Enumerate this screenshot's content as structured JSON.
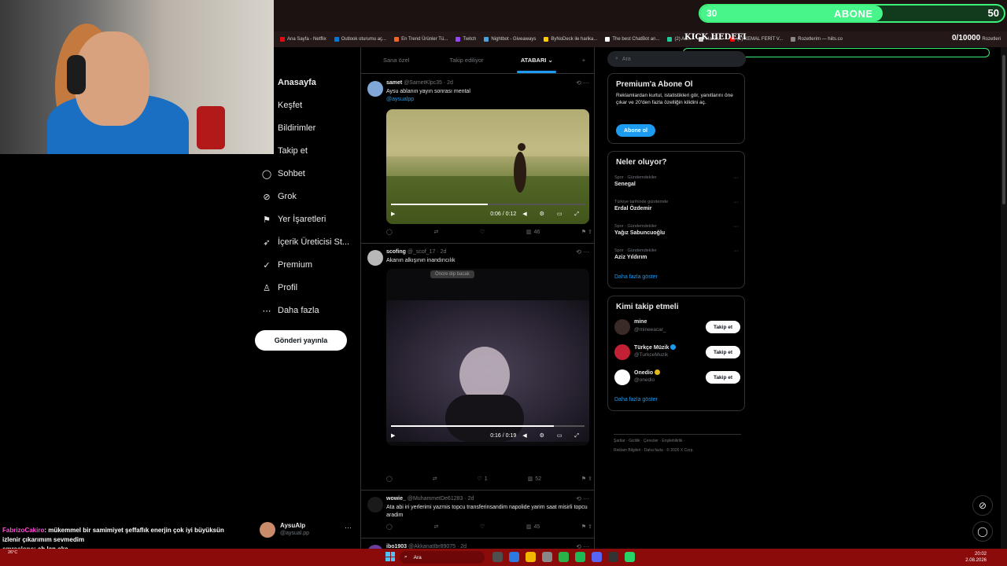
{
  "bookmarks": [
    {
      "label": "Ana Sayfa - Netflix",
      "color": "#e50914"
    },
    {
      "label": "Outlook oturumu aç...",
      "color": "#0078d4"
    },
    {
      "label": "En Trend Ürünler Tü...",
      "color": "#f26522"
    },
    {
      "label": "Twitch",
      "color": "#9146ff"
    },
    {
      "label": "Nightbot - Giveaways",
      "color": "#4aa3df"
    },
    {
      "label": "ByNoDeck ile harika...",
      "color": "#ffcc00"
    },
    {
      "label": "The best ChatBot an...",
      "color": "#ffffff"
    },
    {
      "label": "(2) Ac...",
      "color": "#20c997"
    },
    {
      "label": "Harek...",
      "color": "#cccccc"
    },
    {
      "label": "(1) KEMAL FERİT V...",
      "color": "#ff0000"
    },
    {
      "label": "Rozetlerim — hiits.co",
      "color": "#888888"
    }
  ],
  "bookmarks_more": "Rozetleri",
  "overlay": {
    "goal_start": "30",
    "goal_label": "ABONE",
    "goal_end": "50",
    "goal_progress": 0.6,
    "kick_title": "KICK HEDEFI",
    "kick_count": "0/10000"
  },
  "nav": {
    "items": [
      {
        "label": "Anasayfa",
        "icon": "home-icon",
        "glyph": "⌂"
      },
      {
        "label": "Keşfet",
        "icon": "search-icon",
        "glyph": "⌕"
      },
      {
        "label": "Bildirimler",
        "icon": "bell-icon",
        "glyph": "♪"
      },
      {
        "label": "Takip et",
        "icon": "person-plus-icon",
        "glyph": "☺"
      },
      {
        "label": "Sohbet",
        "icon": "chat-bubble-icon",
        "glyph": "◯"
      },
      {
        "label": "Grok",
        "icon": "grok-icon",
        "glyph": "⊘"
      },
      {
        "label": "Yer İşaretleri",
        "icon": "bookmark-icon",
        "glyph": "⚑"
      },
      {
        "label": "İçerik Üreticisi St...",
        "icon": "rocket-icon",
        "glyph": "➶"
      },
      {
        "label": "Premium",
        "icon": "premium-icon",
        "glyph": "✓"
      },
      {
        "label": "Profil",
        "icon": "profile-icon",
        "glyph": "♙"
      },
      {
        "label": "Daha fazla",
        "icon": "more-circle-icon",
        "glyph": "⋯"
      }
    ],
    "post_button": "Gönderi yayınla"
  },
  "account": {
    "name": "AysuAlp",
    "handle": "@aysual.pp",
    "more": "···"
  },
  "feed": {
    "tabs": [
      {
        "label": "Sana özel",
        "active": false
      },
      {
        "label": "Takip ediliyor",
        "active": false
      },
      {
        "label": "ATABARI ⌄",
        "active": true
      }
    ],
    "tab_add": "+",
    "posts": [
      {
        "author": "samet",
        "handle": "@SametKlpc35 · 2d",
        "text": "Aysu ablanın yayın sonrası mental",
        "link": "@aysualpp",
        "avatar_color": "#7fa8d8",
        "time": "0:06 / 0:12",
        "progress": 0.5,
        "likes": "",
        "views": "46"
      },
      {
        "author": "scofing",
        "handle": "@_scof_17 · 2d",
        "text": "Akanın alkışının inandırıcılık",
        "link": "",
        "avatar_color": "#b8b8b8",
        "chip": "Öncre dip bacak",
        "time": "0:16 / 0:19",
        "progress": 0.84,
        "likes": "1",
        "views": "52"
      },
      {
        "author": "wowie_",
        "handle": "@MuhammetDe61283 · 2d",
        "text": "Ata abi iri yerlerimi yazmis topcu transferinsandim napolide yarim saat misirli topcu aradim",
        "link": "",
        "avatar_color": "#1a1a1a",
        "views": "45"
      },
      {
        "author": "ibo1903",
        "handle": "@AkkanatIbr89075 · 2d",
        "text": "",
        "link": "",
        "avatar_color": "#6b3fa0"
      }
    ]
  },
  "search": {
    "placeholder": "Ara"
  },
  "premium": {
    "title": "Premium'a Abone Ol",
    "text": "Reklamlardan kurtul, istatistikleri gör, yanıtlarını öne çıkar ve 20'den fazla özelliğin kilidini aç.",
    "button": "Abone ol"
  },
  "trends": {
    "title": "Neler oluyor?",
    "items": [
      {
        "category": "Spor · Gündemdekiler",
        "name": "Senegal"
      },
      {
        "category": "Türkiye tarihinde gündemde",
        "name": "Erdal Özdemir"
      },
      {
        "category": "Spor · Gündemdekiler",
        "name": "Yağız Sabuncuoğlu"
      },
      {
        "category": "Spor · Gündemdekiler",
        "name": "Aziz Yıldırım"
      }
    ],
    "show_more": "Daha fazla göster"
  },
  "who_to_follow": {
    "title": "Kimi takip etmeli",
    "items": [
      {
        "name": "mine",
        "handle": "@mineeacar_",
        "button": "Takip et",
        "avatar_color": "#3a2a25",
        "badge": ""
      },
      {
        "name": "Türkçe Müzik",
        "handle": "@TurkceMuzik",
        "button": "Takip et",
        "avatar_color": "#c22035",
        "badge": "blue"
      },
      {
        "name": "Onedio",
        "handle": "@onedio",
        "button": "Takip et",
        "avatar_color": "#ffffff",
        "badge": "gold"
      }
    ],
    "show_more": "Daha fazla göster"
  },
  "footer": {
    "line1": "Şartlar · Gizlilik · Çerezler · Erişilebilirlik ·",
    "line2": "Reklam Bilgileri · Daha fazla · © 2026 X Corp."
  },
  "chat": [
    {
      "user": "FabrizoCakiro",
      "user_color": "#ff4fd8",
      "message": ": mükemmel bir samimiyet şeffaflık enerjin çok iyi büyüksün"
    },
    {
      "user": "",
      "user_color": "#ffffff",
      "message": "izlenir çıkarımım sevmedim"
    },
    {
      "user": "emrealone",
      "user_color": "#d9d9d9",
      "message": ": ah lan aka"
    }
  ],
  "taskbar": {
    "weather": "26°C",
    "search_placeholder": "Ara",
    "time": "20:02",
    "date": "2.08.2026",
    "app_colors": [
      "#4f4f4f",
      "#2a7ae2",
      "#f2b600",
      "#888888",
      "#2bb34a",
      "#1db954",
      "#5865f2",
      "#333333",
      "#25d366"
    ]
  }
}
